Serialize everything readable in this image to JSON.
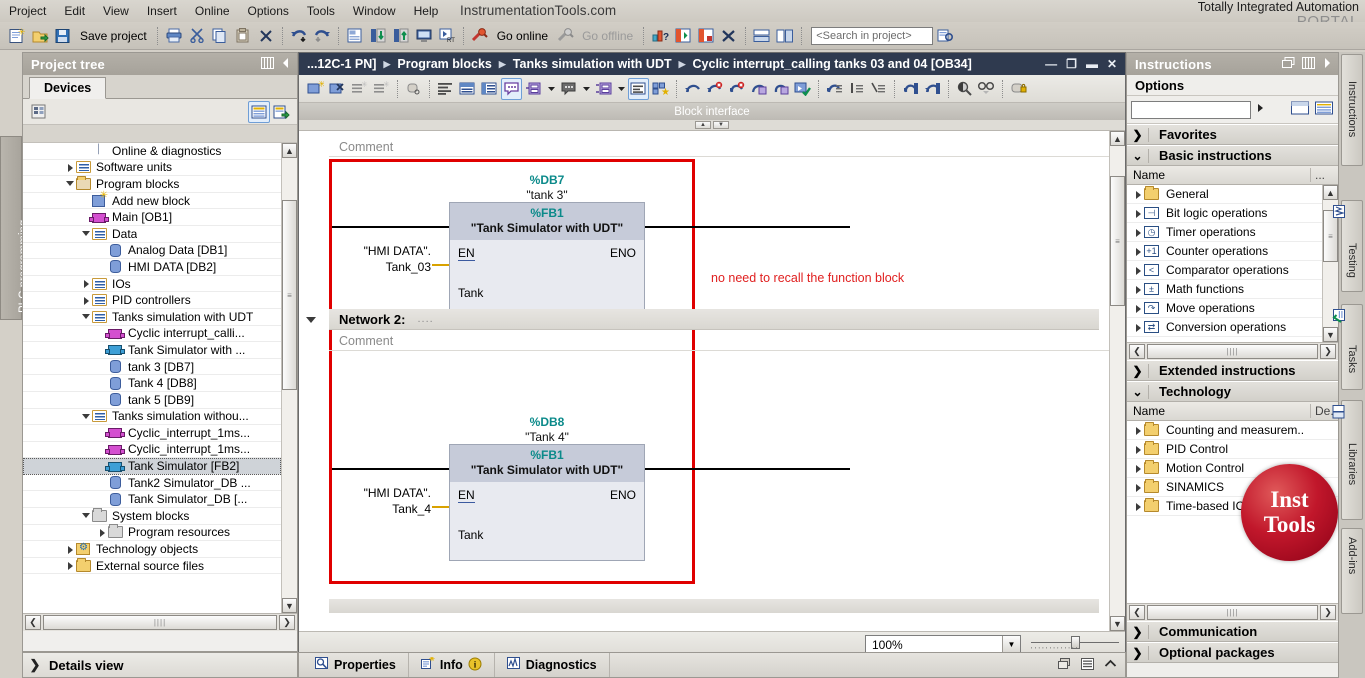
{
  "menu": {
    "items": [
      "Project",
      "Edit",
      "View",
      "Insert",
      "Online",
      "Options",
      "Tools",
      "Window",
      "Help"
    ],
    "site_brand": "InstrumentationTools.com",
    "tia_line1": "Totally Integrated Automation",
    "tia_line2": "PORTAL"
  },
  "toolbar": {
    "save_label": "Save project",
    "go_online": "Go online",
    "go_offline": "Go offline",
    "search_placeholder": "<Search in project>"
  },
  "left_vtab": {
    "label": "PLC programming"
  },
  "project_tree": {
    "title": "Project tree",
    "tab": "Devices",
    "items": [
      {
        "label": "Online & diagnostics",
        "indent": 3,
        "arrow": "none",
        "icon": "diagnostics-icon"
      },
      {
        "label": "Software units",
        "indent": 2,
        "arrow": "right",
        "icon": "folder-group-icon"
      },
      {
        "label": "Program blocks",
        "indent": 2,
        "arrow": "down",
        "icon": "folder-blocks-icon"
      },
      {
        "label": "Add new block",
        "indent": 3,
        "arrow": "none",
        "icon": "add-new-block-icon"
      },
      {
        "label": "Main [OB1]",
        "indent": 3,
        "arrow": "none",
        "icon": "ob-block-icon"
      },
      {
        "label": "Data",
        "indent": 3,
        "arrow": "down",
        "icon": "folder-group-icon"
      },
      {
        "label": "Analog Data [DB1]",
        "indent": 4,
        "arrow": "none",
        "icon": "db-icon"
      },
      {
        "label": "HMI DATA [DB2]",
        "indent": 4,
        "arrow": "none",
        "icon": "db-icon"
      },
      {
        "label": "IOs",
        "indent": 3,
        "arrow": "right",
        "icon": "folder-group-icon"
      },
      {
        "label": "PID controllers",
        "indent": 3,
        "arrow": "right",
        "icon": "folder-group-icon"
      },
      {
        "label": "Tanks simulation with UDT",
        "indent": 3,
        "arrow": "down",
        "icon": "folder-group-icon"
      },
      {
        "label": "Cyclic interrupt_calli...",
        "indent": 4,
        "arrow": "none",
        "icon": "ob-block-icon"
      },
      {
        "label": "Tank Simulator with ...",
        "indent": 4,
        "arrow": "none",
        "icon": "fb-block-icon"
      },
      {
        "label": "tank 3 [DB7]",
        "indent": 4,
        "arrow": "none",
        "icon": "db-icon"
      },
      {
        "label": "Tank 4 [DB8]",
        "indent": 4,
        "arrow": "none",
        "icon": "db-icon"
      },
      {
        "label": "tank 5 [DB9]",
        "indent": 4,
        "arrow": "none",
        "icon": "db-icon"
      },
      {
        "label": "Tanks simulation withou...",
        "indent": 3,
        "arrow": "down",
        "icon": "folder-group-icon"
      },
      {
        "label": "Cyclic_interrupt_1ms...",
        "indent": 4,
        "arrow": "none",
        "icon": "ob-block-icon"
      },
      {
        "label": "Cyclic_interrupt_1ms...",
        "indent": 4,
        "arrow": "none",
        "icon": "ob-block-icon"
      },
      {
        "label": "Tank Simulator [FB2]",
        "indent": 4,
        "arrow": "none",
        "icon": "fb-block-icon",
        "selected": true
      },
      {
        "label": "Tank2 Simulator_DB ...",
        "indent": 4,
        "arrow": "none",
        "icon": "db-icon"
      },
      {
        "label": "Tank Simulator_DB [...",
        "indent": 4,
        "arrow": "none",
        "icon": "db-icon"
      },
      {
        "label": "System blocks",
        "indent": 3,
        "arrow": "down",
        "icon": "system-blocks-icon"
      },
      {
        "label": "Program resources",
        "indent": 4,
        "arrow": "right",
        "icon": "system-blocks-icon"
      },
      {
        "label": "Technology objects",
        "indent": 2,
        "arrow": "right",
        "icon": "technology-objects-icon"
      },
      {
        "label": "External source files",
        "indent": 2,
        "arrow": "right",
        "icon": "folder-icon"
      }
    ],
    "details_view": "Details view"
  },
  "editor": {
    "breadcrumb": [
      "...12C-1 PN]",
      "Program blocks",
      "Tanks simulation with UDT",
      "Cyclic interrupt_calling tanks 03 and 04 [OB34]"
    ],
    "block_interface": "Block interface",
    "zoom_value": "100%",
    "networks": [
      {
        "id": "network-1",
        "comment": "Comment",
        "db_number": "%DB7",
        "db_name": "\"tank 3\"",
        "fb_number": "%FB1",
        "fb_name": "\"Tank Simulator with UDT\"",
        "pin_en": "EN",
        "pin_eno": "ENO",
        "pin_in": "Tank",
        "operand_line1": "\"HMI DATA\".",
        "operand_line2": "Tank_03"
      },
      {
        "id": "network-2",
        "header": "Network 2:",
        "header_dots": "....",
        "comment": "Comment",
        "db_number": "%DB8",
        "db_name": "\"Tank 4\"",
        "fb_number": "%FB1",
        "fb_name": "\"Tank Simulator with UDT\"",
        "pin_en": "EN",
        "pin_eno": "ENO",
        "pin_in": "Tank",
        "operand_line1": "\"HMI DATA\".",
        "operand_line2": "Tank_4"
      }
    ],
    "annotation": "no need to recall the function block",
    "annotation_color": "#e02020",
    "highlight_color": "#e00000"
  },
  "status_tabs": [
    {
      "label": "Properties",
      "icon": "properties-icon"
    },
    {
      "label": "Info",
      "icon": "info-icon",
      "badge": "i"
    },
    {
      "label": "Diagnostics",
      "icon": "diagnostics-icon"
    }
  ],
  "instructions": {
    "title": "Instructions",
    "options_label": "Options",
    "search_value": "",
    "sections": [
      {
        "label": "Favorites",
        "expanded": false
      },
      {
        "label": "Basic instructions",
        "expanded": true
      },
      {
        "label": "Extended instructions",
        "expanded": false
      },
      {
        "label": "Technology",
        "expanded": true
      },
      {
        "label": "Communication",
        "expanded": false
      },
      {
        "label": "Optional packages",
        "expanded": false
      }
    ],
    "basic_columns": [
      "Name",
      "..."
    ],
    "basic_items": [
      {
        "label": "General",
        "icon": "folder-icon"
      },
      {
        "label": "Bit logic operations",
        "icon": "bit-logic-icon"
      },
      {
        "label": "Timer operations",
        "icon": "timer-icon"
      },
      {
        "label": "Counter operations",
        "icon": "counter-icon"
      },
      {
        "label": "Comparator operations",
        "icon": "comparator-icon"
      },
      {
        "label": "Math functions",
        "icon": "math-icon"
      },
      {
        "label": "Move operations",
        "icon": "move-icon"
      },
      {
        "label": "Conversion operations",
        "icon": "conversion-icon"
      }
    ],
    "tech_columns": [
      "Name",
      "De..."
    ],
    "tech_items": [
      {
        "label": "Counting and measurem..",
        "icon": "folder-icon"
      },
      {
        "label": "PID Control",
        "icon": "folder-icon"
      },
      {
        "label": "Motion Control",
        "icon": "folder-icon"
      },
      {
        "label": "SINAMICS",
        "icon": "folder-icon"
      },
      {
        "label": "Time-based IO",
        "icon": "folder-icon"
      }
    ]
  },
  "right_vtabs": [
    {
      "label": "Instructions",
      "icon": "instructions-icon"
    },
    {
      "label": "Testing",
      "icon": "testing-icon"
    },
    {
      "label": "Tasks",
      "icon": "tasks-icon"
    },
    {
      "label": "Libraries",
      "icon": "libraries-icon"
    },
    {
      "label": "Add-ins",
      "icon": "addins-icon"
    }
  ],
  "watermark": {
    "line1": "Inst",
    "line2": "Tools",
    "color": "#c1172b"
  }
}
